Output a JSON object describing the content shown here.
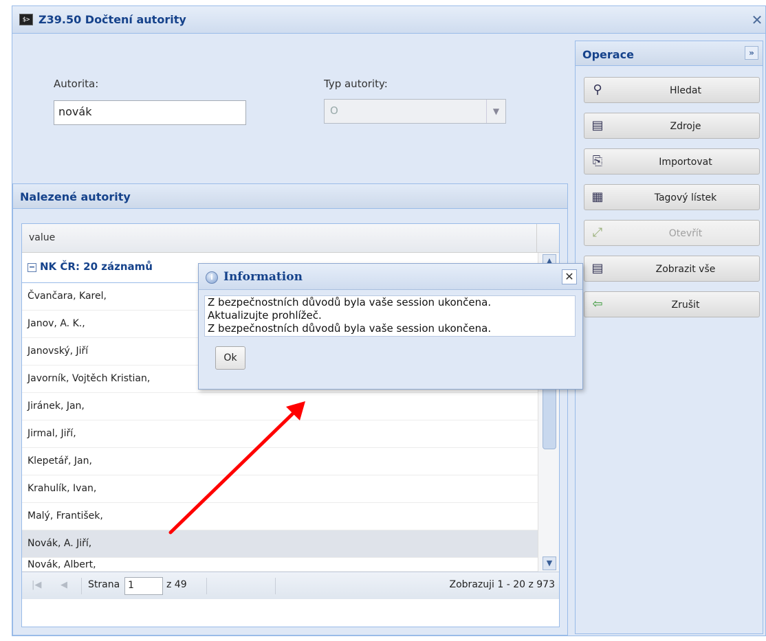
{
  "window": {
    "title": "Z39.50 Dočtení autority",
    "icon_text": "$>"
  },
  "form": {
    "autorita_label": "Autorita:",
    "autorita_value": "novák",
    "typ_label": "Typ autority:",
    "typ_value": "O"
  },
  "results": {
    "header": "Nalezené autority",
    "column": "value",
    "group_label": "NK ČR: 20 záznamů",
    "rows": [
      "Čvančara, Karel,",
      "Janov, A. K.,",
      "Janovský, Jiří",
      "Javorník, Vojtěch Kristian,",
      "Jiránek, Jan,",
      "Jirmal, Jiří,",
      "Klepetář, Jan,",
      "Krahulík, Ivan,",
      "Malý, František,",
      "Novák, A. Jiří,",
      "Novák, Albert,"
    ],
    "selected_index": 9
  },
  "paging": {
    "page_label": "Strana",
    "page_value": "1",
    "of_label": "z 49",
    "summary": "Zobrazuji 1 - 20 z 973"
  },
  "operations": {
    "header": "Operace",
    "buttons": [
      {
        "label": "Hledat",
        "icon": "search-icon",
        "enabled": true
      },
      {
        "label": "Zdroje",
        "icon": "list-icon",
        "enabled": true
      },
      {
        "label": "Importovat",
        "icon": "import-icon",
        "enabled": true
      },
      {
        "label": "Tagový lístek",
        "icon": "document-icon",
        "enabled": true
      },
      {
        "label": "Otevřít",
        "icon": "expand-icon",
        "enabled": false
      },
      {
        "label": "Zobrazit vše",
        "icon": "list-icon",
        "enabled": true
      },
      {
        "label": "Zrušit",
        "icon": "back-arrow-icon",
        "enabled": true
      }
    ]
  },
  "dialog": {
    "title": "Information",
    "line1": "Z bezpečnostních důvodů byla vaše session ukončena.",
    "line2": "Aktualizujte prohlížeč.",
    "line3": "Z bezpečnostních důvodů byla vaše session ukončena.",
    "ok_label": "Ok"
  },
  "colors": {
    "panel_bg": "#dfe8f6",
    "header_text": "#15428b",
    "annotation_arrow": "#ff0000"
  }
}
